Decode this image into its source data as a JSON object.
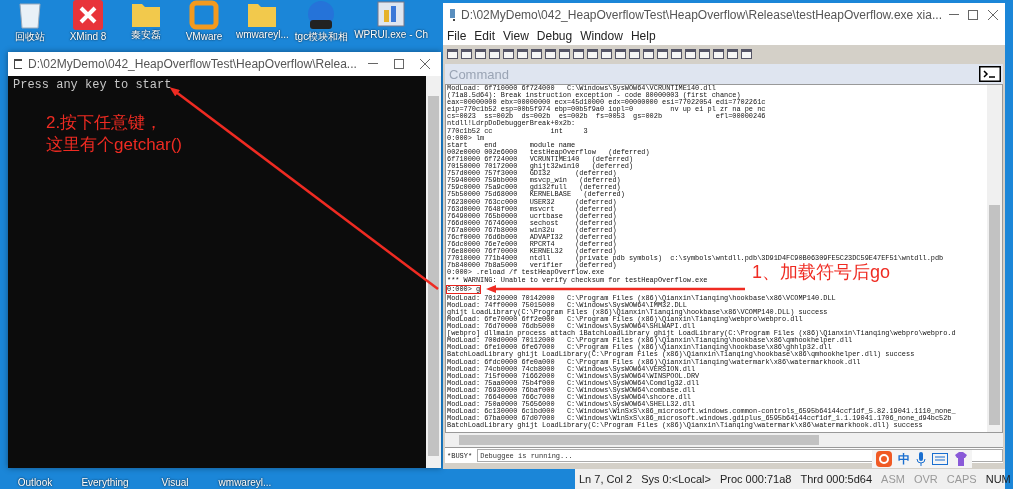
{
  "desktop_icons": [
    {
      "label": "回收站",
      "kind": "recycle"
    },
    {
      "label": "XMind 8",
      "kind": "xmind"
    },
    {
      "label": "秦安磊",
      "kind": "folder"
    },
    {
      "label": "VMware",
      "kind": "vmware"
    },
    {
      "label": "wmwareyl...",
      "kind": "folder"
    },
    {
      "label": "tgc模块和相",
      "kind": "zip"
    },
    {
      "label": "WPRUI.exe - Ch",
      "kind": "app"
    }
  ],
  "bottom_icons": [
    {
      "label": "Outlook"
    },
    {
      "label": "Everything"
    },
    {
      "label": "Visual"
    },
    {
      "label": "wmwareyl..."
    }
  ],
  "console": {
    "title": "D:\\02MyDemo\\042_HeapOverflowTest\\HeapOverflow\\Relea...",
    "lines": [
      "Press any key to start"
    ]
  },
  "debugger": {
    "title": "D:\\02MyDemo\\042_HeapOverflowTest\\HeapOverflow\\Release\\testHeapOverflow.exe xia...",
    "menu": [
      "File",
      "Edit",
      "View",
      "Debug",
      "Window",
      "Help"
    ],
    "pane_title": "Command",
    "output": [
      {
        "text": "ModLoad: 6f710000 6f724000   C:\\Windows\\SysWOW64\\VCRUNTIME140.dll",
        "highlighted": false
      },
      {
        "text": "(71a8.5d64): Break instruction exception - code 80000003 (first chance)",
        "highlighted": false
      },
      {
        "text": "eax=00000000 ebx=00000000 ecx=45d10000 edx=00000000 esi=77022054 edi=7702261c",
        "highlighted": false
      },
      {
        "text": "eip=770c1b52 esp=00b5f974 ebp=00b5f9a0 iopl=0         nv up ei pl zr na pe nc",
        "highlighted": false
      },
      {
        "text": "cs=0023  ss=002b  ds=002b  es=002b  fs=0053  gs=002b             efl=00000246",
        "highlighted": false
      },
      {
        "text": "ntdll!LdrpDoDebuggerBreak+0x2b:",
        "highlighted": false
      },
      {
        "text": "770c1b52 cc              int     3",
        "highlighted": false
      },
      {
        "text": "0:000> lm",
        "highlighted": false
      },
      {
        "text": "start    end        module name",
        "highlighted": false
      },
      {
        "text": "002e0000 002e6000   testHeapOverflow   (deferred)",
        "highlighted": false
      },
      {
        "text": "6f710000 6f724000   VCRUNTIME140   (deferred)",
        "highlighted": false
      },
      {
        "text": "70150000 70172000   ghijt32win10   (deferred)",
        "highlighted": false
      },
      {
        "text": "757d0000 757f3000   GDI32      (deferred)",
        "highlighted": false
      },
      {
        "text": "75940000 759bb000   msvcp_win   (deferred)",
        "highlighted": false
      },
      {
        "text": "759c0000 75a9c000   gdi32full   (deferred)",
        "highlighted": false
      },
      {
        "text": "75b50000 75d68000   KERNELBASE   (deferred)",
        "highlighted": false
      },
      {
        "text": "76230000 763cc000   USER32     (deferred)",
        "highlighted": false
      },
      {
        "text": "763d0000 7648f000   msvcrt     (deferred)",
        "highlighted": false
      },
      {
        "text": "76490000 765b0000   ucrtbase   (deferred)",
        "highlighted": false
      },
      {
        "text": "766d0000 76746000   sechost    (deferred)",
        "highlighted": false
      },
      {
        "text": "767a0000 767b8000   win32u     (deferred)",
        "highlighted": false
      },
      {
        "text": "76cf0000 76d6b000   ADVAPI32   (deferred)",
        "highlighted": false
      },
      {
        "text": "76dc0000 76e7e000   RPCRT4     (deferred)",
        "highlighted": false
      },
      {
        "text": "76e80000 76f70000   KERNEL32   (deferred)",
        "highlighted": false
      },
      {
        "text": "77010000 771b4000   ntdll      (private pdb symbols)  c:\\symbols\\wntdll.pdb\\3D91D4FC90B06309FE5C23DC59E47EF51\\wntdll.pdb",
        "highlighted": false
      },
      {
        "text": "7b840000 7b8a5000   verifier   (deferred)",
        "highlighted": false
      },
      {
        "text": "0:000> .reload /f testHeapOverflow.exe",
        "highlighted": false
      },
      {
        "text": "*** WARNING: Unable to verify checksum for testHeapOverflow.exe",
        "highlighted": false
      },
      {
        "text": "0:000> g",
        "highlighted": true
      },
      {
        "text": "ModLoad: 70120000 70142000   C:\\Program Files (x86)\\Qianxin\\Tianqing\\hookbase\\x86\\VCOMP140.DLL",
        "highlighted": false
      },
      {
        "text": "ModLoad: 74ff0000 75015000   C:\\Windows\\SysWOW64\\IMM32.DLL",
        "highlighted": false
      },
      {
        "text": "ghijt LoadLibrary(C:\\Program Files (x86)\\Qianxin\\Tianqing\\hookbase\\x86\\VCOMP140.DLL) success",
        "highlighted": false
      },
      {
        "text": "ModLoad: 6fe70000 6ff2e000   C:\\Program Files (x86)\\Qianxin\\Tianqing\\webpro\\webpro.dll",
        "highlighted": false
      },
      {
        "text": "ModLoad: 76d70000 76db5000   C:\\Windows\\SysWOW64\\SHLWAPI.dll",
        "highlighted": false
      },
      {
        "text": "[webpro] dllmain process attach 1BatchLoadLibrary ghijt LoadLibrary(C:\\Program Files (x86)\\Qianxin\\Tianqing\\webpro\\webpro.d",
        "highlighted": false
      },
      {
        "text": "ModLoad: 700d0000 70112000   C:\\Program Files (x86)\\Qianxin\\Tianqing\\hookbase\\x86\\qmhookhelper.dll",
        "highlighted": false
      },
      {
        "text": "ModLoad: 6fe10000 6fe67000   C:\\Program Files (x86)\\Qianxin\\Tianqing\\hookbase\\x86\\ghhlp32.dll",
        "highlighted": false
      },
      {
        "text": "BatchLoadLibrary ghijt LoadLibrary(C:\\Program Files (x86)\\Qianxin\\Tianqing\\hookbase\\x86\\qmhookhelper.dll) success",
        "highlighted": false
      },
      {
        "text": "ModLoad: 6fdc0000 6fe0a000   C:\\Program Files (x86)\\Qianxin\\Tianqing\\watermark\\x86\\watermarkhook.dll",
        "highlighted": false
      },
      {
        "text": "ModLoad: 74cb0000 74cb8000   C:\\Windows\\SysWOW64\\VERSION.dll",
        "highlighted": false
      },
      {
        "text": "ModLoad: 715f0000 71662000   C:\\Windows\\SysWOW64\\WINSPOOL.DRV",
        "highlighted": false
      },
      {
        "text": "ModLoad: 75aa0000 75b4f000   C:\\Windows\\SysWOW64\\Comdlg32.dll",
        "highlighted": false
      },
      {
        "text": "ModLoad: 76930000 76baf000   C:\\Windows\\SysWOW64\\combase.dll",
        "highlighted": false
      },
      {
        "text": "ModLoad: 76640000 766c7000   C:\\Windows\\SysWOW64\\shcore.dll",
        "highlighted": false
      },
      {
        "text": "ModLoad: 750a0000 75656000   C:\\Windows\\SysWOW64\\SHELL32.dll",
        "highlighted": false
      },
      {
        "text": "ModLoad: 6c130000 6c1bd000   C:\\Windows\\WinSxS\\x86_microsoft.windows.common-controls_6595b64144ccf1df_5.82.19041.1110_none_",
        "highlighted": false
      },
      {
        "text": "ModLoad: 67ba0000 67d07000   C:\\Windows\\WinSxS\\x86_microsoft.windows.gdiplus_6595b64144ccf1df_1.1.19041.1706_none_d94bc52b",
        "highlighted": false
      },
      {
        "text": "BatchLoadLibrary ghijt LoadLibrary(C:\\Program Files (x86)\\Qianxin\\Tianqing\\watermark\\x86\\watermarkhook.dll) success",
        "highlighted": false
      }
    ],
    "prompt_status": "*BUSY*",
    "input_text": "Debuggee is running...",
    "status_bar": [
      {
        "text": "Ln 7, Col 2",
        "on": true
      },
      {
        "text": "Sys 0:<Local>",
        "on": true
      },
      {
        "text": "Proc 000:71a8",
        "on": true
      },
      {
        "text": "Thrd 000:5d64",
        "on": true
      },
      {
        "text": "ASM",
        "on": false
      },
      {
        "text": "OVR",
        "on": false
      },
      {
        "text": "CAPS",
        "on": false
      },
      {
        "text": "NUM",
        "on": true
      }
    ]
  },
  "annotations": [
    {
      "lines": [
        "2.按下任意键，",
        "这里有个getchar()"
      ]
    },
    {
      "lines": [
        "1、加载符号后go"
      ]
    }
  ],
  "tray": {
    "ime": "中"
  }
}
